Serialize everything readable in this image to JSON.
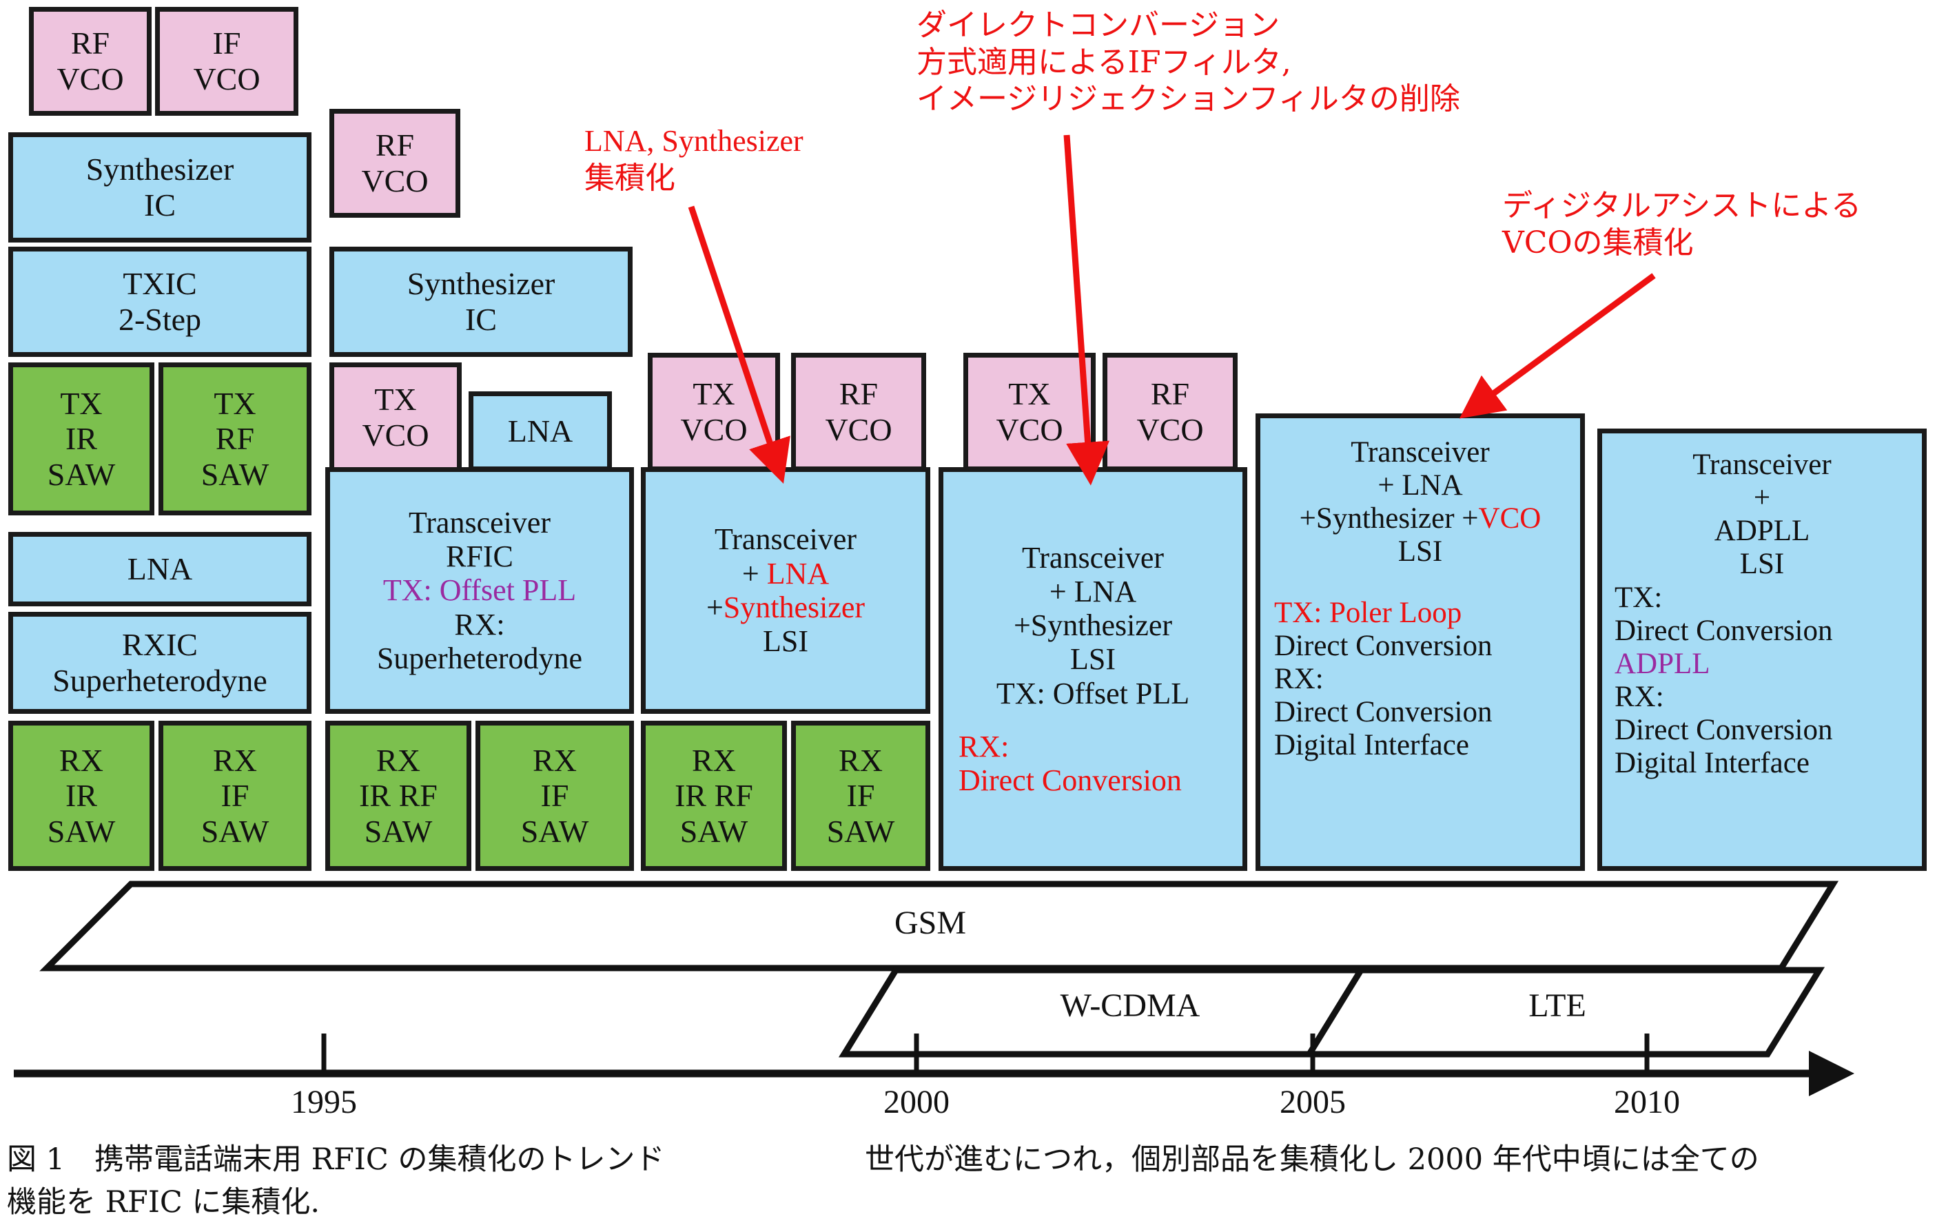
{
  "figure": {
    "caption_left": "図 1　携帯電話端末用 RFIC の集積化のトレンド\n機能を RFIC に集積化.",
    "caption_right": "世代が進むにつれ，個別部品を集積化し 2000 年代中頃には全ての"
  },
  "colors": {
    "pink": "#eec4de",
    "blue": "#a6dcf5",
    "green": "#7cc04e",
    "outline": "#1a1a1a",
    "annotation_red": "#ee1111",
    "highlight_purple": "#9a2aa0"
  },
  "annotations": [
    {
      "id": "lna-synth",
      "text": "LNA, Synthesizer\n集積化"
    },
    {
      "id": "direct-conv",
      "text": "ダイレクトコンバージョン\n方式適用によるIFフィルタ,\nイメージリジェクションフィルタの削除"
    },
    {
      "id": "digital-assist",
      "text": "ディジタルアシストによる\nVCOの集積化"
    }
  ],
  "blocks": [
    {
      "id": "rf-vco-1",
      "color": "pink",
      "lines": [
        {
          "t": "RF"
        },
        {
          "t": "VCO"
        }
      ]
    },
    {
      "id": "if-vco-1",
      "color": "pink",
      "lines": [
        {
          "t": "IF"
        },
        {
          "t": "VCO"
        }
      ]
    },
    {
      "id": "synth-ic-1",
      "color": "blue",
      "lines": [
        {
          "t": "Synthesizer"
        },
        {
          "t": "IC"
        }
      ]
    },
    {
      "id": "txic-2step",
      "color": "blue",
      "lines": [
        {
          "t": "TXIC"
        },
        {
          "t": "2-Step"
        }
      ]
    },
    {
      "id": "tx-ir-saw",
      "color": "green",
      "lines": [
        {
          "t": "TX"
        },
        {
          "t": "IR"
        },
        {
          "t": "SAW"
        }
      ]
    },
    {
      "id": "tx-rf-saw",
      "color": "green",
      "lines": [
        {
          "t": "TX"
        },
        {
          "t": "RF"
        },
        {
          "t": "SAW"
        }
      ]
    },
    {
      "id": "lna-1",
      "color": "blue",
      "lines": [
        {
          "t": "LNA"
        }
      ]
    },
    {
      "id": "rxic-super",
      "color": "blue",
      "lines": [
        {
          "t": "RXIC"
        },
        {
          "t": "Superheterodyne"
        }
      ]
    },
    {
      "id": "rx-ir-saw-1",
      "color": "green",
      "lines": [
        {
          "t": "RX"
        },
        {
          "t": "IR"
        },
        {
          "t": "SAW"
        }
      ]
    },
    {
      "id": "rx-if-saw-1",
      "color": "green",
      "lines": [
        {
          "t": "RX"
        },
        {
          "t": "IF"
        },
        {
          "t": "SAW"
        }
      ]
    },
    {
      "id": "rf-vco-2",
      "color": "pink",
      "lines": [
        {
          "t": "RF"
        },
        {
          "t": "VCO"
        }
      ]
    },
    {
      "id": "synth-ic-2",
      "color": "blue",
      "lines": [
        {
          "t": "Synthesizer"
        },
        {
          "t": "IC"
        }
      ]
    },
    {
      "id": "tx-vco-2",
      "color": "pink",
      "lines": [
        {
          "t": "TX"
        },
        {
          "t": "VCO"
        }
      ]
    },
    {
      "id": "lna-2",
      "color": "blue",
      "lines": [
        {
          "t": "LNA"
        }
      ]
    },
    {
      "id": "transceiver-rfic",
      "color": "blue",
      "lines": [
        {
          "t": "Transceiver"
        },
        {
          "t": "RFIC"
        },
        {
          "t": "TX: Offset PLL",
          "c": "purple"
        },
        {
          "t": "RX:"
        },
        {
          "t": "Superheterodyne"
        }
      ]
    },
    {
      "id": "rx-ir-rf-saw-2",
      "color": "green",
      "lines": [
        {
          "t": "RX"
        },
        {
          "t": "IR RF"
        },
        {
          "t": "SAW"
        }
      ]
    },
    {
      "id": "rx-if-saw-2",
      "color": "green",
      "lines": [
        {
          "t": "RX"
        },
        {
          "t": "IF"
        },
        {
          "t": "SAW"
        }
      ]
    },
    {
      "id": "tx-vco-3",
      "color": "pink",
      "lines": [
        {
          "t": "TX"
        },
        {
          "t": "VCO"
        }
      ]
    },
    {
      "id": "rf-vco-3",
      "color": "pink",
      "lines": [
        {
          "t": "RF"
        },
        {
          "t": "VCO"
        }
      ]
    },
    {
      "id": "transceiver-lna-synth-lsi",
      "color": "blue",
      "lines": [
        {
          "t": "Transceiver"
        },
        {
          "t": "+ LNA",
          "c": "red",
          "prefix": "+ ",
          "prefix_plain": true
        },
        {
          "t": "+Synthesizer",
          "c": "red",
          "prefix": "+",
          "prefix_plain": true
        },
        {
          "t": "LSI"
        }
      ]
    },
    {
      "id": "rx-ir-rf-saw-3",
      "color": "green",
      "lines": [
        {
          "t": "RX"
        },
        {
          "t": "IR RF"
        },
        {
          "t": "SAW"
        }
      ]
    },
    {
      "id": "rx-if-saw-3",
      "color": "green",
      "lines": [
        {
          "t": "RX"
        },
        {
          "t": "IF"
        },
        {
          "t": "SAW"
        }
      ]
    },
    {
      "id": "tx-vco-4",
      "color": "pink",
      "lines": [
        {
          "t": "TX"
        },
        {
          "t": "VCO"
        }
      ]
    },
    {
      "id": "rf-vco-4",
      "color": "pink",
      "lines": [
        {
          "t": "RF"
        },
        {
          "t": "VCO"
        }
      ]
    },
    {
      "id": "transceiver-offsetpll-dc",
      "color": "blue",
      "lines": [
        {
          "t": "Transceiver"
        },
        {
          "t": "+ LNA"
        },
        {
          "t": "+Synthesizer"
        },
        {
          "t": "LSI"
        },
        {
          "t": "TX: Offset PLL"
        },
        {
          "t": ""
        },
        {
          "t": "RX:",
          "c": "red"
        },
        {
          "t": "Direct Conversion",
          "c": "red"
        }
      ]
    },
    {
      "id": "transceiver-vco-lsi",
      "color": "blue",
      "lines": [
        {
          "t": "Transceiver"
        },
        {
          "t": "+ LNA"
        },
        {
          "t": "+Synthesizer +VCO",
          "c": "mixed-vco"
        },
        {
          "t": "LSI"
        },
        {
          "t": ""
        },
        {
          "t": "TX: Poler Loop",
          "c": "red"
        },
        {
          "t": " Direct Conversion"
        },
        {
          "t": "RX:"
        },
        {
          "t": " Direct Conversion"
        },
        {
          "t": "Digital Interface"
        }
      ]
    },
    {
      "id": "transceiver-adpll-lsi",
      "color": "blue",
      "lines": [
        {
          "t": "Transceiver"
        },
        {
          "t": "+"
        },
        {
          "t": "ADPLL"
        },
        {
          "t": "LSI"
        },
        {
          "t": "TX:"
        },
        {
          "t": "Direct Conversion"
        },
        {
          "t": "ADPLL",
          "c": "purple"
        },
        {
          "t": "RX:"
        },
        {
          "t": "Direct Conversion"
        },
        {
          "t": "Digital Interface"
        }
      ]
    }
  ],
  "standards": [
    {
      "id": "gsm",
      "label": "GSM"
    },
    {
      "id": "wcdma",
      "label": "W-CDMA"
    },
    {
      "id": "lte",
      "label": "LTE"
    }
  ],
  "timeline": {
    "years": [
      "1995",
      "2000",
      "2005",
      "2010"
    ]
  }
}
